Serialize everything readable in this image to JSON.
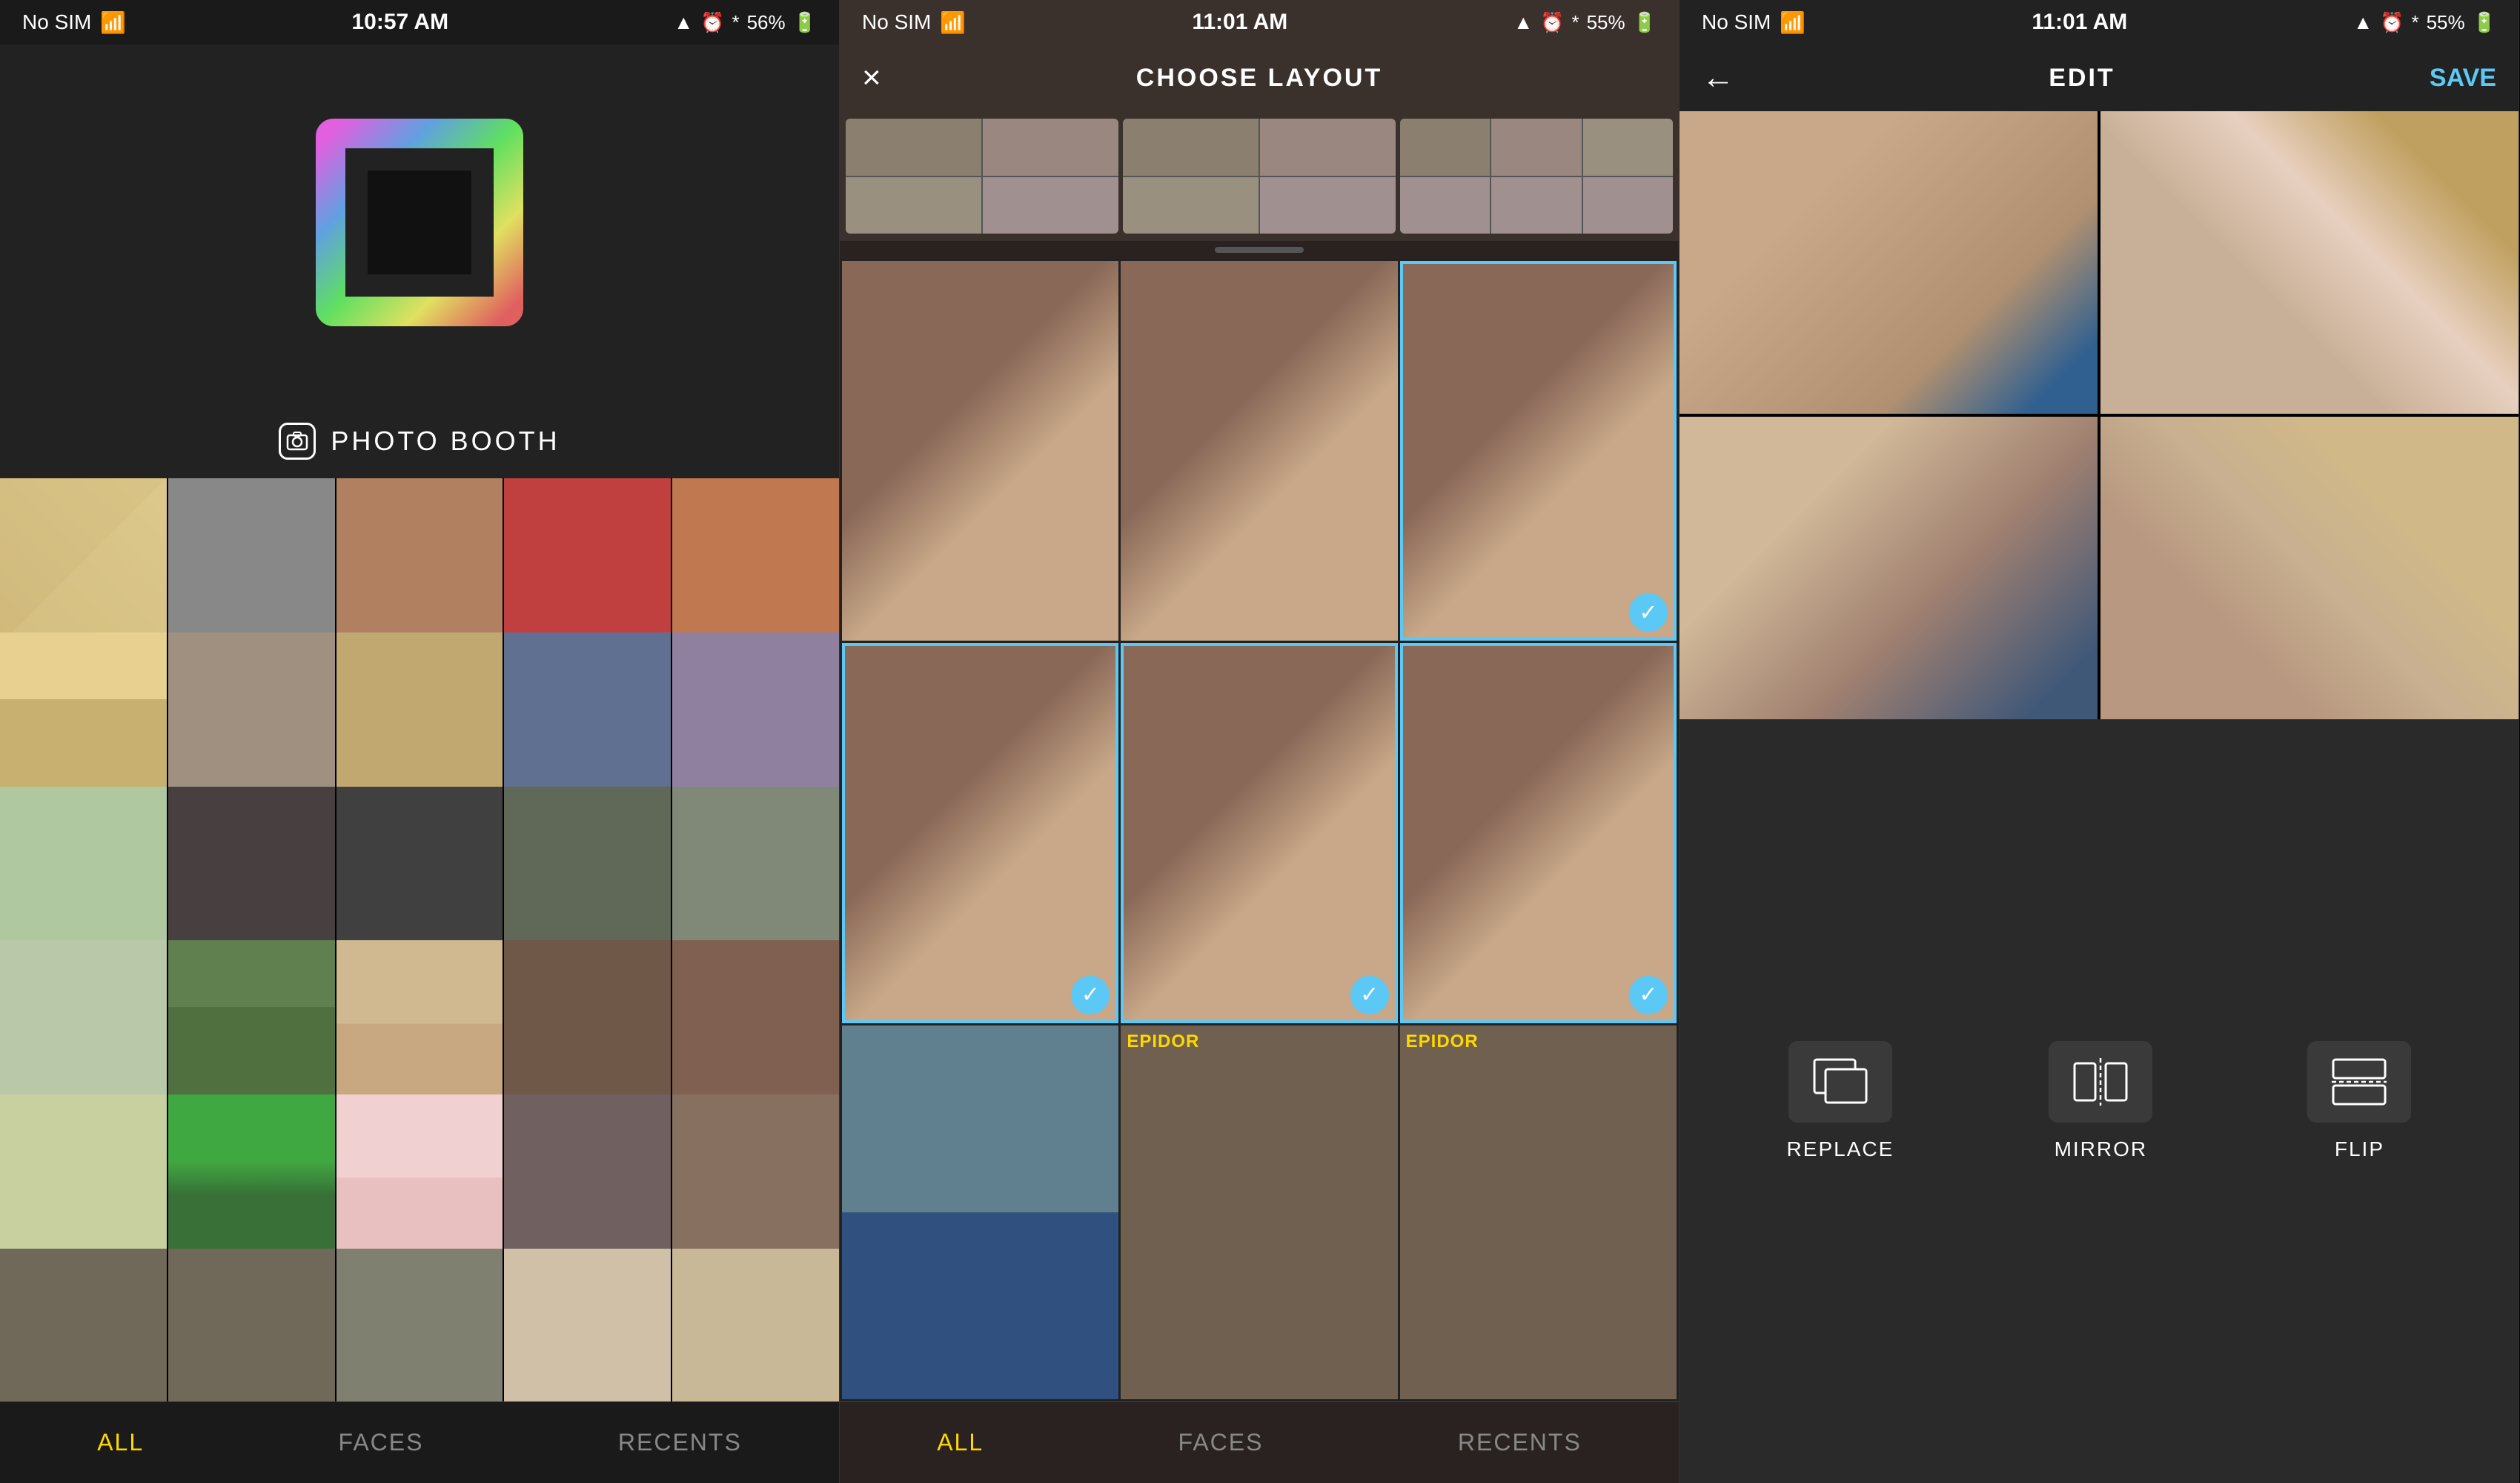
{
  "screens": [
    {
      "id": "screen1",
      "statusBar": {
        "left": "No SIM",
        "center": "10:57 AM",
        "right": "56%"
      },
      "logoBrand": "PHOTO BOOTH",
      "bottomNav": {
        "items": [
          "ALL",
          "FACES",
          "RECENTS"
        ],
        "active": 0
      }
    },
    {
      "id": "screen2",
      "statusBar": {
        "left": "No SIM",
        "center": "11:01 AM",
        "right": "55%"
      },
      "title": "CHOOSE LAYOUT",
      "closeLabel": "×",
      "scrollIndicator": true,
      "bottomNav": {
        "items": [
          "ALL",
          "FACES",
          "RECENTS"
        ],
        "active": 0
      },
      "selectionPhotos": [
        {
          "id": 1,
          "selected": false,
          "label": ""
        },
        {
          "id": 2,
          "selected": false,
          "label": ""
        },
        {
          "id": 3,
          "selected": true,
          "label": ""
        },
        {
          "id": 4,
          "selected": true,
          "label": ""
        },
        {
          "id": 5,
          "selected": true,
          "label": ""
        },
        {
          "id": 6,
          "selected": false,
          "label": ""
        },
        {
          "id": 7,
          "selected": false,
          "label": "EPIDOR"
        },
        {
          "id": 8,
          "selected": false,
          "label": "EPIDOR"
        },
        {
          "id": 9,
          "selected": false,
          "label": ""
        }
      ]
    },
    {
      "id": "screen3",
      "statusBar": {
        "left": "No SIM",
        "center": "11:01 AM",
        "right": "55%"
      },
      "title": "EDIT",
      "saveLabel": "SAVE",
      "backIcon": "←",
      "tools": [
        {
          "id": "replace",
          "label": "REPLACE"
        },
        {
          "id": "mirror",
          "label": "MIRROR"
        },
        {
          "id": "flip",
          "label": "FLIP"
        }
      ]
    }
  ],
  "icons": {
    "close": "✕",
    "check": "✓",
    "back": "←",
    "wifi": "wifi",
    "battery": "battery",
    "location": "▲",
    "bluetooth": "bluetooth",
    "clock": "clock"
  }
}
